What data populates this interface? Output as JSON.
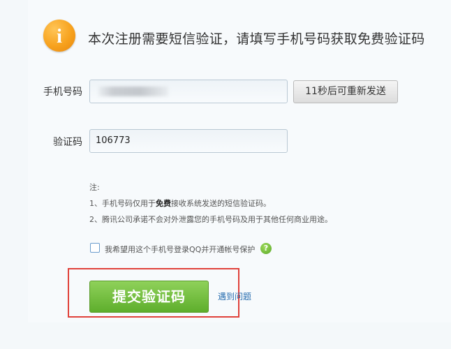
{
  "header": {
    "icon": "info-icon",
    "icon_glyph": "i",
    "message": "本次注册需要短信验证，请填写手机号码获取免费验证码"
  },
  "form": {
    "phone": {
      "label": "手机号码",
      "value": ""
    },
    "resend_label": "11秒后可重新发送",
    "code": {
      "label": "验证码",
      "value": "106773"
    }
  },
  "notes": {
    "title": "注:",
    "line1_prefix": "1、手机号码仅用于",
    "line1_bold": "免费",
    "line1_suffix": "接收系统发送的短信验证码。",
    "line2": "2、腾讯公司承诺不会对外泄露您的手机号码及用于其他任何商业用途。"
  },
  "protection": {
    "label": "我希望用这个手机号登录QQ并开通帐号保护",
    "checked": false,
    "help_icon": "help-icon",
    "help_glyph": "?"
  },
  "actions": {
    "submit_label": "提交验证码",
    "problem_link": "遇到问题"
  },
  "colors": {
    "info_icon": "#f7a21e",
    "submit_button": "#6ab536",
    "highlight_box": "#e0413a",
    "link": "#2a6fb0"
  }
}
